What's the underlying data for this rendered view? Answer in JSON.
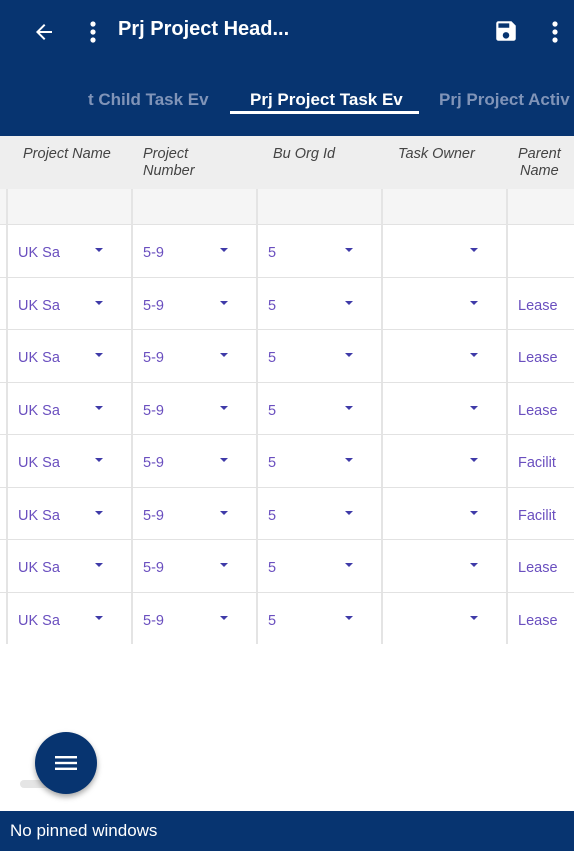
{
  "header": {
    "title": "Prj Project Head...",
    "back_icon": "arrow-left-icon",
    "menu_icon": "more-vert-icon",
    "save_icon": "floppy-disk-icon"
  },
  "tabs": [
    {
      "label": "t Child Task Ev"
    },
    {
      "label": "Prj Project Task Ev"
    },
    {
      "label": "Prj Project Activ"
    }
  ],
  "grid": {
    "columns": [
      {
        "line1": "Project Name",
        "line2": ""
      },
      {
        "line1": "Project",
        "line2": "Number"
      },
      {
        "line1": "Bu Org Id",
        "line2": ""
      },
      {
        "line1": "Task Owner",
        "line2": ""
      },
      {
        "line1": "Parent",
        "line2": "Name"
      }
    ],
    "rows": [
      [
        "UK Sa",
        "5-9",
        "5",
        "",
        ""
      ],
      [
        "UK Sa",
        "5-9",
        "5",
        "",
        "Lease"
      ],
      [
        "UK Sa",
        "5-9",
        "5",
        "",
        "Lease"
      ],
      [
        "UK Sa",
        "5-9",
        "5",
        "",
        "Lease"
      ],
      [
        "UK Sa",
        "5-9",
        "5",
        "",
        "Facilit"
      ],
      [
        "UK Sa",
        "5-9",
        "5",
        "",
        "Facilit"
      ],
      [
        "UK Sa",
        "5-9",
        "5",
        "",
        "Lease"
      ],
      [
        "UK Sa",
        "5-9",
        "5",
        "",
        "Lease"
      ]
    ]
  },
  "fab": {
    "icon": "hamburger-menu-icon"
  },
  "footer": {
    "text": "No pinned windows"
  },
  "colors": {
    "primary": "#073470",
    "value_text": "#6a4fbf",
    "header_bg": "#eeeeee"
  }
}
